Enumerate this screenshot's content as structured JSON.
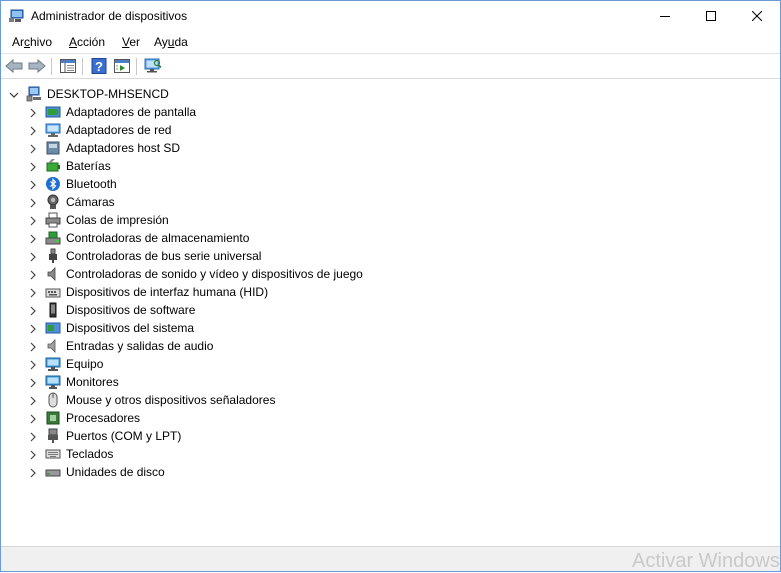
{
  "window": {
    "title": "Administrador de dispositivos",
    "app_icon": "device-manager-icon",
    "border_color": "#6b9ad8"
  },
  "caption_buttons": [
    "minimize-icon",
    "maximize-icon",
    "close-icon"
  ],
  "menu": {
    "items": [
      {
        "pre": "Ar",
        "accel": "c",
        "post": "hivo"
      },
      {
        "pre": "",
        "accel": "A",
        "post": "cción"
      },
      {
        "pre": "",
        "accel": "V",
        "post": "er"
      },
      {
        "pre": "Ay",
        "accel": "u",
        "post": "da"
      }
    ]
  },
  "toolbar": {
    "buttons": [
      "back-icon",
      "forward-icon",
      "show-hide-console-tree-icon",
      "help-icon",
      "run-action-icon",
      "scan-hardware-icon"
    ]
  },
  "tree": {
    "root": {
      "label": "DESKTOP-MHSENCD",
      "icon": "computer-root-icon",
      "expanded": true
    },
    "categories": [
      {
        "label": "Adaptadores de pantalla",
        "icon": "display-adapter-icon"
      },
      {
        "label": "Adaptadores de red",
        "icon": "network-adapter-icon"
      },
      {
        "label": "Adaptadores host SD",
        "icon": "sd-host-icon"
      },
      {
        "label": "Baterías",
        "icon": "battery-icon"
      },
      {
        "label": "Bluetooth",
        "icon": "bluetooth-icon"
      },
      {
        "label": "Cámaras",
        "icon": "camera-icon"
      },
      {
        "label": "Colas de impresión",
        "icon": "printer-icon"
      },
      {
        "label": "Controladoras de almacenamiento",
        "icon": "storage-controller-icon"
      },
      {
        "label": "Controladoras de bus serie universal",
        "icon": "usb-icon"
      },
      {
        "label": "Controladoras de sonido y vídeo y dispositivos de juego",
        "icon": "speaker-icon"
      },
      {
        "label": "Dispositivos de interfaz humana (HID)",
        "icon": "hid-icon"
      },
      {
        "label": "Dispositivos de software",
        "icon": "software-device-icon"
      },
      {
        "label": "Dispositivos del sistema",
        "icon": "system-device-icon"
      },
      {
        "label": "Entradas y salidas de audio",
        "icon": "audio-io-icon"
      },
      {
        "label": "Equipo",
        "icon": "computer-icon"
      },
      {
        "label": "Monitores",
        "icon": "monitor-icon"
      },
      {
        "label": "Mouse y otros dispositivos señaladores",
        "icon": "mouse-icon"
      },
      {
        "label": "Procesadores",
        "icon": "processor-icon"
      },
      {
        "label": "Puertos (COM y LPT)",
        "icon": "port-icon"
      },
      {
        "label": "Teclados",
        "icon": "keyboard-icon"
      },
      {
        "label": "Unidades de disco",
        "icon": "disk-drive-icon"
      }
    ]
  },
  "watermark": "Activar Windows"
}
